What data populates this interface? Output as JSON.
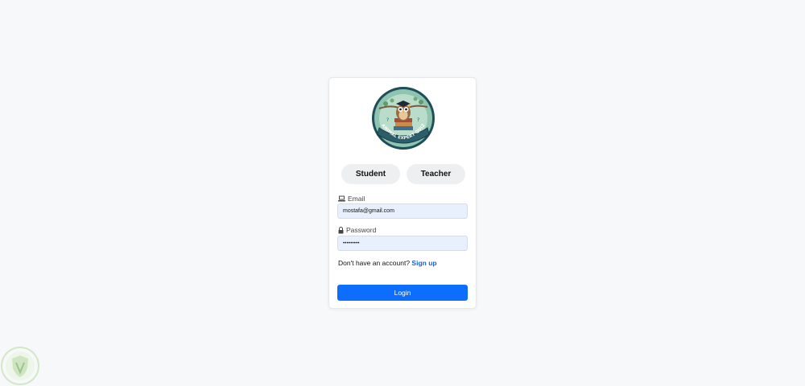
{
  "logo": {
    "text": "ANIMAL EXPERT QUIZ",
    "icon": "owl-on-books-badge"
  },
  "roles": [
    {
      "label": "Student"
    },
    {
      "label": "Teacher"
    }
  ],
  "form": {
    "email": {
      "label": "Email",
      "value": "mostafa@gmail.com",
      "icon": "laptop-icon"
    },
    "password": {
      "label": "Password",
      "value": "•••••••••",
      "icon": "lock-icon"
    },
    "signup_prompt": "Don't have an account?",
    "signup_link": "Sign up",
    "login_label": "Login"
  },
  "colors": {
    "primary": "#0d6efd",
    "link": "#1c5fd6",
    "input_bg": "#e8f0fe",
    "background": "#f7f8fa"
  }
}
